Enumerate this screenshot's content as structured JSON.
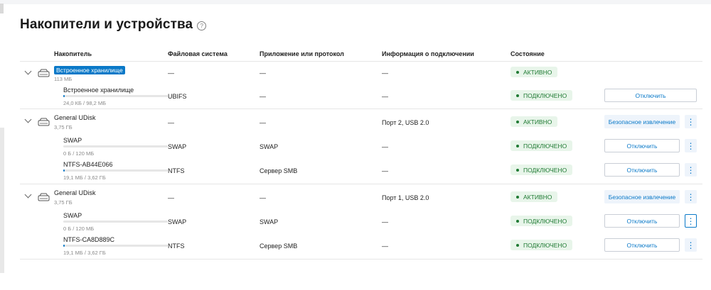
{
  "title": "Накопители и устройства",
  "help_icon": "?",
  "headers": {
    "drive": "Накопитель",
    "fs": "Файловая система",
    "app": "Приложение или протокол",
    "conn": "Информация о подключении",
    "state": "Состояние"
  },
  "dash": "—",
  "disks": [
    {
      "name": "Встроенное хранилище",
      "size": "113 МБ",
      "conn": "—",
      "state": "АКТИВНО",
      "eject_label": "",
      "partitions": [
        {
          "name": "Встроенное хранилище",
          "usage": "24,0 КБ / 98,2 МБ",
          "fill": 0.01,
          "fs": "UBIFS",
          "app": "—",
          "conn": "—",
          "state": "ПОДКЛЮЧЕНО",
          "button": "Отключить",
          "kebab": false
        }
      ]
    },
    {
      "name": "General UDisk",
      "size": "3,75 ГБ",
      "conn": "Порт 2, USB 2.0",
      "state": "АКТИВНО",
      "eject_label": "Безопасное извлечение",
      "partitions": [
        {
          "name": "SWAP",
          "usage": "0 Б / 120 МБ",
          "fill": 0.0,
          "fs": "SWAP",
          "app": "SWAP",
          "conn": "—",
          "state": "ПОДКЛЮЧЕНО",
          "button": "Отключить",
          "kebab": true
        },
        {
          "name": "NTFS-AB44E066",
          "usage": "19,1 МБ / 3,62 ГБ",
          "fill": 0.01,
          "fs": "NTFS",
          "app": "Сервер SMB",
          "conn": "—",
          "state": "ПОДКЛЮЧЕНО",
          "button": "Отключить",
          "kebab": true
        }
      ]
    },
    {
      "name": "General UDisk",
      "size": "3,75 ГБ",
      "conn": "Порт 1, USB 2.0",
      "state": "АКТИВНО",
      "eject_label": "Безопасное извлечение",
      "partitions": [
        {
          "name": "SWAP",
          "usage": "0 Б / 120 МБ",
          "fill": 0.0,
          "fs": "SWAP",
          "app": "SWAP",
          "conn": "—",
          "state": "ПОДКЛЮЧЕНО",
          "button": "Отключить",
          "kebab": true
        },
        {
          "name": "NTFS-CA8D889C",
          "usage": "19,1 МБ / 3,62 ГБ",
          "fill": 0.01,
          "fs": "NTFS",
          "app": "Сервер SMB",
          "conn": "—",
          "state": "ПОДКЛЮЧЕНО",
          "button": "Отключить",
          "kebab": true
        }
      ]
    }
  ],
  "icons": {
    "expand": "chevron-down-icon",
    "drive": "hard-drive-icon",
    "more": "kebab-menu-icon"
  },
  "colors": {
    "accent": "#0a79c8",
    "status_bg": "#e8f5ea",
    "status_fg": "#1f7a33"
  }
}
